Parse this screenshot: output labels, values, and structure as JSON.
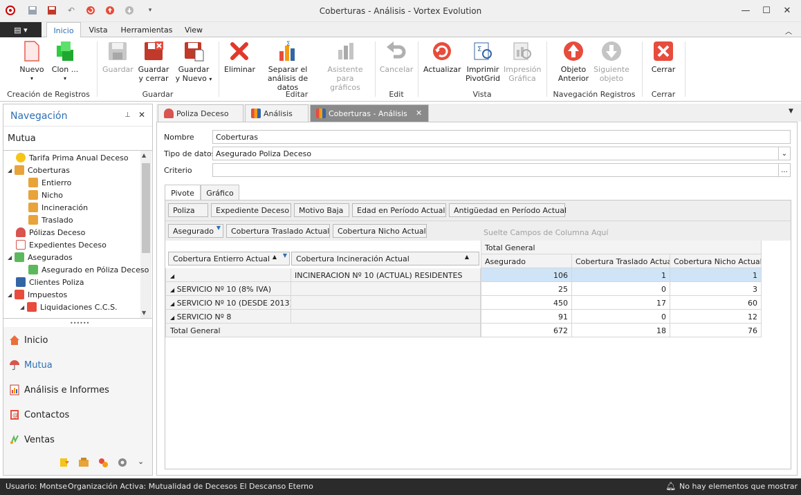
{
  "window": {
    "title": "Coberturas - Análisis - Vortex Evolution"
  },
  "menu_tabs": [
    "Inicio",
    "Vista",
    "Herramientas",
    "View"
  ],
  "ribbon": {
    "buttons": {
      "nuevo": "Nuevo",
      "clon": "Clon ...",
      "guardar": "Guardar",
      "guardar_cerrar_1": "Guardar",
      "guardar_cerrar_2": "y cerrar",
      "guardar_nuevo_1": "Guardar",
      "guardar_nuevo_2": "y Nuevo",
      "eliminar": "Eliminar",
      "separar_1": "Separar el",
      "separar_2": "análisis de datos",
      "asistente_1": "Asistente",
      "asistente_2": "para gráficos",
      "cancelar": "Cancelar",
      "actualizar": "Actualizar",
      "imprimir_1": "Imprimir",
      "imprimir_2": "PivotGrid",
      "impresion_1": "Impresión",
      "impresion_2": "Gráfica",
      "objeto_anterior_1": "Objeto",
      "objeto_anterior_2": "Anterior",
      "siguiente_1": "Siguiente",
      "siguiente_2": "objeto",
      "cerrar": "Cerrar"
    },
    "groups": [
      "Creación de Registros",
      "Guardar",
      "Editar",
      "Edit",
      "Vista",
      "Navegación Registros",
      "Cerrar"
    ]
  },
  "navigation": {
    "title": "Navegación",
    "section": "Mutua",
    "tree": [
      "Tarifa Prima Anual Deceso",
      "Coberturas",
      "Entierro",
      "Nicho",
      "Incineración",
      "Traslado",
      "Pólizas Deceso",
      "Expedientes Deceso",
      "Asegurados",
      "Asegurado en Póliza Deceso",
      "Clientes Poliza",
      "Impuestos",
      "Liquidaciones C.C.S."
    ],
    "buttons": [
      "Inicio",
      "Mutua",
      "Análisis e Informes",
      "Contactos",
      "Ventas"
    ]
  },
  "doc_tabs": [
    "Poliza Deceso",
    "Análisis",
    "Coberturas - Análisis"
  ],
  "form": {
    "nombre_label": "Nombre",
    "nombre_value": "Coberturas",
    "tipo_label": "Tipo de datos",
    "tipo_value": "Asegurado Poliza Deceso",
    "criterio_label": "Criterio",
    "criterio_value": "",
    "ellipsis": "..."
  },
  "inner_tabs": [
    "Pivote",
    "Gráfico"
  ],
  "pivot": {
    "filter_fields": [
      "Poliza",
      "Expediente Deceso",
      "Motivo Baja",
      "Edad en Período Actual",
      "Antigüedad en Período Actual"
    ],
    "data_fields": [
      "Asegurado",
      "Cobertura Traslado Actual",
      "Cobertura Nicho Actual"
    ],
    "column_drop_hint": "Suelte Campos de Columna Aquí",
    "row_fields": [
      "Cobertura Entierro Actual",
      "Cobertura Incineración Actual"
    ],
    "total_general_header": "Total General",
    "value_headers": [
      "Asegurado",
      "Cobertura Traslado Actual",
      "Cobertura Nicho Actual"
    ],
    "rows": [
      {
        "r1": "",
        "r2": "INCINERACION Nº 10 (ACTUAL) RESIDENTES",
        "v": [
          "106",
          "1",
          "1"
        ]
      },
      {
        "r1": "SERVICIO Nº 10 (8% IVA)",
        "r2": "",
        "v": [
          "25",
          "0",
          "3"
        ]
      },
      {
        "r1": "SERVICIO Nº 10 (DESDE 2013)",
        "r2": "",
        "v": [
          "450",
          "17",
          "60"
        ]
      },
      {
        "r1": "SERVICIO Nº 8",
        "r2": "",
        "v": [
          "91",
          "0",
          "12"
        ]
      }
    ],
    "total_row": {
      "label": "Total General",
      "v": [
        "672",
        "18",
        "76"
      ]
    }
  },
  "status": {
    "user": "Usuario: Montse",
    "org": "Organización Activa: Mutualidad de Decesos El Descanso Eterno",
    "notifications": "No hay elementos que mostrar"
  },
  "colors": {
    "accent": "#2b6fb5",
    "statusbar": "#2b2b2b",
    "highlight": "#cfe4f7"
  }
}
